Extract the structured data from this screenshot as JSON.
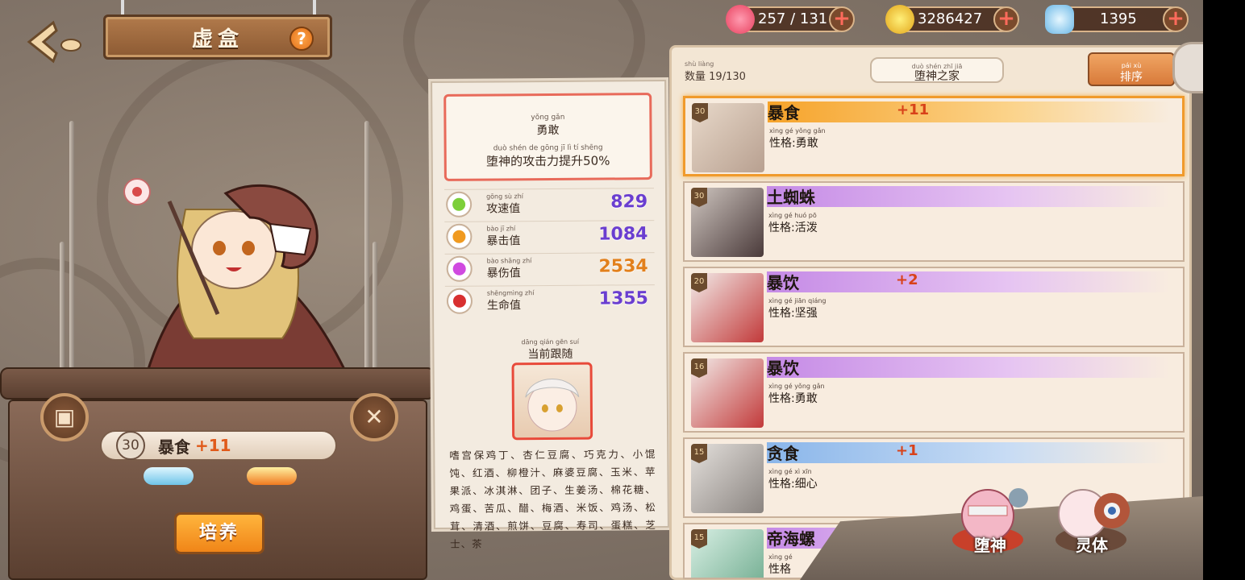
{
  "header": {
    "title": "虚盒",
    "help_label": "?"
  },
  "currencies": [
    {
      "name": "stamina",
      "icon": "heart-icon",
      "value": "257 / 131",
      "color": "#ff5b7a"
    },
    {
      "name": "gold",
      "icon": "coin-icon",
      "value": "3286427",
      "color": "#f2c230"
    },
    {
      "name": "crystal",
      "icon": "crystal-icon",
      "value": "1395",
      "color": "#8fd0f0"
    }
  ],
  "currency_add_label": "+",
  "character": {
    "level": "30",
    "name": "暴食",
    "plus": "+11",
    "cultivate_label": "培养"
  },
  "details": {
    "trait_pinyin": "yǒng gǎn",
    "trait_name": "勇敢",
    "trait_desc_pinyin": "duò shén de gōng jī lì tí shēng",
    "trait_desc": "堕神的攻击力提升50%",
    "stats": [
      {
        "pinyin": "gōng sù zhí",
        "label": "攻速值",
        "value": "829",
        "color": "#6a3ed0",
        "icon_color": "#7ccf3a"
      },
      {
        "pinyin": "bào jī zhí",
        "label": "暴击值",
        "value": "1084",
        "color": "#6a3ed0",
        "icon_color": "#f09a20"
      },
      {
        "pinyin": "bào shāng zhí",
        "label": "暴伤值",
        "value": "2534",
        "color": "#e2801c",
        "icon_color": "#d04ae0"
      },
      {
        "pinyin": "shēngmìng zhí",
        "label": "生命值",
        "value": "1355",
        "color": "#6a3ed0",
        "icon_color": "#d83030"
      }
    ],
    "follow_pinyin": "dāng qián gēn suí",
    "follow_title": "当前跟随",
    "likes_text": "嗜宫保鸡丁、杏仁豆腐、巧克力、小馄饨、红酒、柳橙汁、麻婆豆腐、玉米、苹果派、冰淇淋、团子、生姜汤、棉花糖、鸡蛋、苦瓜、醋、梅酒、米饭、鸡汤、松茸、清酒、煎饼、豆腐、寿司、蛋糕、芝士、茶"
  },
  "panel": {
    "count_pinyin": "shù liàng",
    "count_label": "数量",
    "count_value": "19/130",
    "home_pinyin": "duò shén zhī jiā",
    "home_label": "堕神之家",
    "sort_pinyin": "pái xù",
    "sort_label": "排序"
  },
  "list": [
    {
      "level": "30",
      "name": "暴食",
      "plus": "+11",
      "trait_pinyin": "xìng gé  yǒng gǎn",
      "trait": "性格:勇敢",
      "band": "orange",
      "selected": true
    },
    {
      "level": "30",
      "name": "土蜘蛛",
      "plus": "",
      "trait_pinyin": "xìng gé  huó pō",
      "trait": "性格:活泼",
      "band": "purple",
      "selected": false
    },
    {
      "level": "20",
      "name": "暴饮",
      "plus": "+2",
      "trait_pinyin": "xìng gé  jiān qiáng",
      "trait": "性格:坚强",
      "band": "purple",
      "selected": false
    },
    {
      "level": "16",
      "name": "暴饮",
      "plus": "",
      "trait_pinyin": "xìng gé  yǒng gǎn",
      "trait": "性格:勇敢",
      "band": "purple",
      "selected": false
    },
    {
      "level": "15",
      "name": "贪食",
      "plus": "+1",
      "trait_pinyin": "xìng gé  xì xīn",
      "trait": "性格:细心",
      "band": "blue",
      "selected": false
    },
    {
      "level": "15",
      "name": "帝海螺",
      "plus": "",
      "trait_pinyin": "xìng gé",
      "trait": "性格",
      "band": "purple",
      "selected": false
    }
  ],
  "bottom_buttons": [
    {
      "label": "堕神"
    },
    {
      "label": "灵体"
    }
  ]
}
